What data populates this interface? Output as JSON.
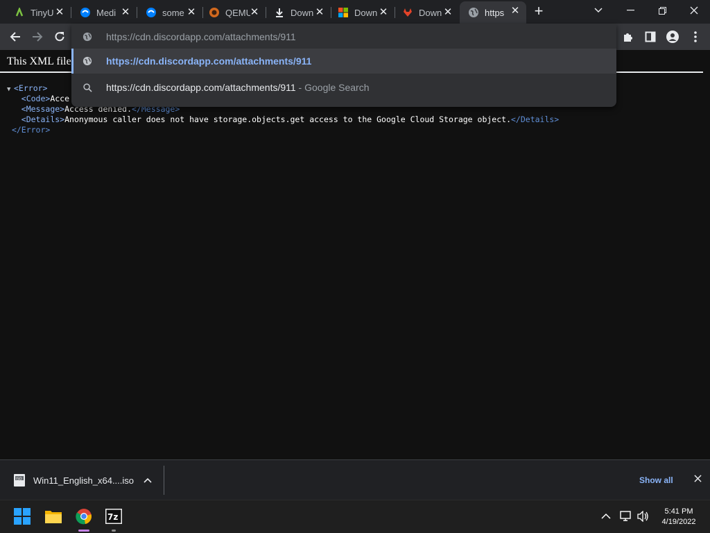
{
  "tabs": [
    {
      "title": "TinyU",
      "icon": "tinyurl-favicon-icon"
    },
    {
      "title": "Medi",
      "icon": "digitalocean-favicon-icon"
    },
    {
      "title": "some",
      "icon": "digitalocean-favicon-icon"
    },
    {
      "title": "QEMU",
      "icon": "qemu-favicon-icon"
    },
    {
      "title": "Down",
      "icon": "download-icon"
    },
    {
      "title": "Down",
      "icon": "microsoft-favicon-icon"
    },
    {
      "title": "Down",
      "icon": "gitlab-favicon-icon"
    },
    {
      "title": "https",
      "icon": "globe-icon",
      "active": true
    }
  ],
  "omnibox": {
    "input_host": "https://cdn.discordapp.com",
    "input_path": "/attachments/911",
    "suggestions": [
      {
        "text": "https://cdn.discordapp.com/attachments/911",
        "suffix": "",
        "icon": "globe-icon"
      },
      {
        "text": "https://cdn.discordapp.com/attachments/911",
        "suffix": " - Google Search",
        "icon": "search-icon"
      }
    ]
  },
  "page": {
    "xml_notice": "This XML file",
    "xml": {
      "error_open": "<Error>",
      "code_open": "<Code>",
      "code_text": "Acce",
      "message_open": "<Message>",
      "message_text": "Access denied.",
      "message_close": "</Message>",
      "details_open": "<Details>",
      "details_text": "Anonymous caller does not have storage.objects.get access to the Google Cloud Storage object.",
      "details_close": "</Details>",
      "error_close": "</Error>"
    }
  },
  "download_bar": {
    "file_name": "Win11_English_x64....iso",
    "show_all": "Show all"
  },
  "taskbar": {
    "time": "5:41 PM",
    "date": "4/19/2022"
  },
  "colors": {
    "accent": "#8ab4f8",
    "tab_strip": "#202124",
    "toolbar": "#35363a",
    "omnibox": "#303134"
  }
}
